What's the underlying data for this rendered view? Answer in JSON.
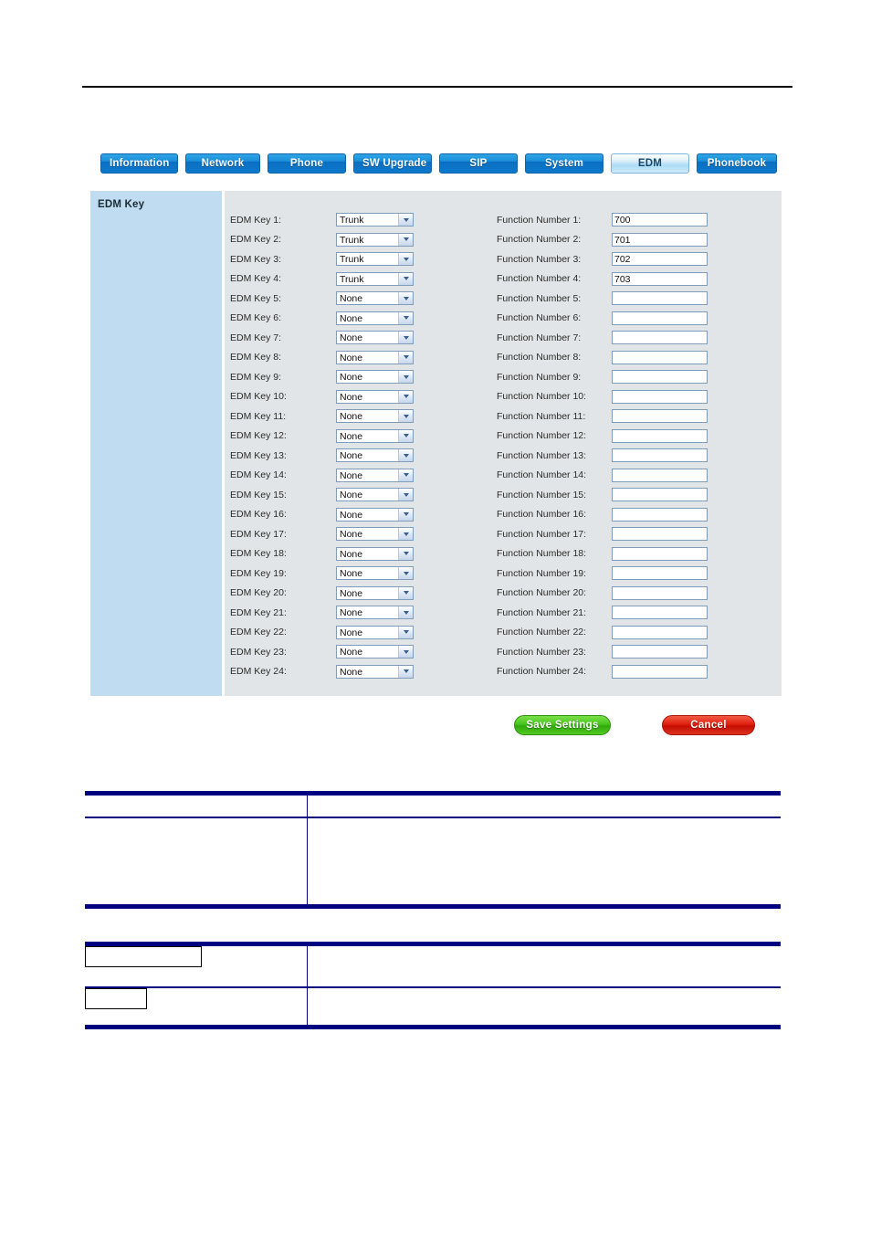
{
  "page": {
    "header_rule": true
  },
  "tabs": [
    {
      "id": "information",
      "label": "Information",
      "active": false
    },
    {
      "id": "network",
      "label": "Network",
      "active": false
    },
    {
      "id": "phone",
      "label": "Phone",
      "active": false
    },
    {
      "id": "sw-upgrade",
      "label": "SW Upgrade",
      "active": false
    },
    {
      "id": "sip",
      "label": "SIP",
      "active": false
    },
    {
      "id": "system",
      "label": "System",
      "active": false
    },
    {
      "id": "edm",
      "label": "EDM",
      "active": true
    },
    {
      "id": "phonebook",
      "label": "Phonebook",
      "active": false
    }
  ],
  "panel": {
    "section_title": "EDM Key",
    "select_options": [
      "None",
      "Trunk"
    ],
    "rows": [
      {
        "key_label": "EDM Key 1:",
        "key_value": "Trunk",
        "fn_label": "Function Number 1:",
        "fn_value": "700"
      },
      {
        "key_label": "EDM Key 2:",
        "key_value": "Trunk",
        "fn_label": "Function Number 2:",
        "fn_value": "701"
      },
      {
        "key_label": "EDM Key 3:",
        "key_value": "Trunk",
        "fn_label": "Function Number 3:",
        "fn_value": "702"
      },
      {
        "key_label": "EDM Key 4:",
        "key_value": "Trunk",
        "fn_label": "Function Number 4:",
        "fn_value": "703"
      },
      {
        "key_label": "EDM Key 5:",
        "key_value": "None",
        "fn_label": "Function Number 5:",
        "fn_value": ""
      },
      {
        "key_label": "EDM Key 6:",
        "key_value": "None",
        "fn_label": "Function Number 6:",
        "fn_value": ""
      },
      {
        "key_label": "EDM Key 7:",
        "key_value": "None",
        "fn_label": "Function Number 7:",
        "fn_value": ""
      },
      {
        "key_label": "EDM Key 8:",
        "key_value": "None",
        "fn_label": "Function Number 8:",
        "fn_value": ""
      },
      {
        "key_label": "EDM Key 9:",
        "key_value": "None",
        "fn_label": "Function Number 9:",
        "fn_value": ""
      },
      {
        "key_label": "EDM Key 10:",
        "key_value": "None",
        "fn_label": "Function Number 10:",
        "fn_value": ""
      },
      {
        "key_label": "EDM Key 11:",
        "key_value": "None",
        "fn_label": "Function Number 11:",
        "fn_value": ""
      },
      {
        "key_label": "EDM Key 12:",
        "key_value": "None",
        "fn_label": "Function Number 12:",
        "fn_value": ""
      },
      {
        "key_label": "EDM Key 13:",
        "key_value": "None",
        "fn_label": "Function Number 13:",
        "fn_value": ""
      },
      {
        "key_label": "EDM Key 14:",
        "key_value": "None",
        "fn_label": "Function Number 14:",
        "fn_value": ""
      },
      {
        "key_label": "EDM Key 15:",
        "key_value": "None",
        "fn_label": "Function Number 15:",
        "fn_value": ""
      },
      {
        "key_label": "EDM Key 16:",
        "key_value": "None",
        "fn_label": "Function Number 16:",
        "fn_value": ""
      },
      {
        "key_label": "EDM Key 17:",
        "key_value": "None",
        "fn_label": "Function Number 17:",
        "fn_value": ""
      },
      {
        "key_label": "EDM Key 18:",
        "key_value": "None",
        "fn_label": "Function Number 18:",
        "fn_value": ""
      },
      {
        "key_label": "EDM Key 19:",
        "key_value": "None",
        "fn_label": "Function Number 19:",
        "fn_value": ""
      },
      {
        "key_label": "EDM Key 20:",
        "key_value": "None",
        "fn_label": "Function Number 20:",
        "fn_value": ""
      },
      {
        "key_label": "EDM Key 21:",
        "key_value": "None",
        "fn_label": "Function Number 21:",
        "fn_value": ""
      },
      {
        "key_label": "EDM Key 22:",
        "key_value": "None",
        "fn_label": "Function Number 22:",
        "fn_value": ""
      },
      {
        "key_label": "EDM Key 23:",
        "key_value": "None",
        "fn_label": "Function Number 23:",
        "fn_value": ""
      },
      {
        "key_label": "EDM Key 24:",
        "key_value": "None",
        "fn_label": "Function Number 24:",
        "fn_value": ""
      }
    ]
  },
  "actions": {
    "save_label": "Save Settings",
    "cancel_label": "Cancel"
  },
  "doc_tables": [
    {
      "id": "table-a",
      "header": {
        "col1": "",
        "col2": ""
      },
      "rows": [
        {
          "col1": "",
          "col2": ""
        }
      ]
    },
    {
      "id": "table-b",
      "rows": [
        {
          "col1_box": "",
          "col2": ""
        },
        {
          "col1_box": "",
          "col2": ""
        }
      ]
    }
  ],
  "colors": {
    "tab_blue": "#1b8ed8",
    "tab_active": "#aadcf5",
    "panel_sidebar": "#bfdcf0",
    "panel_body": "#e2e5e7",
    "save_green": "#47c41d",
    "cancel_red": "#e02010",
    "table_rule_navy": "#000080"
  }
}
